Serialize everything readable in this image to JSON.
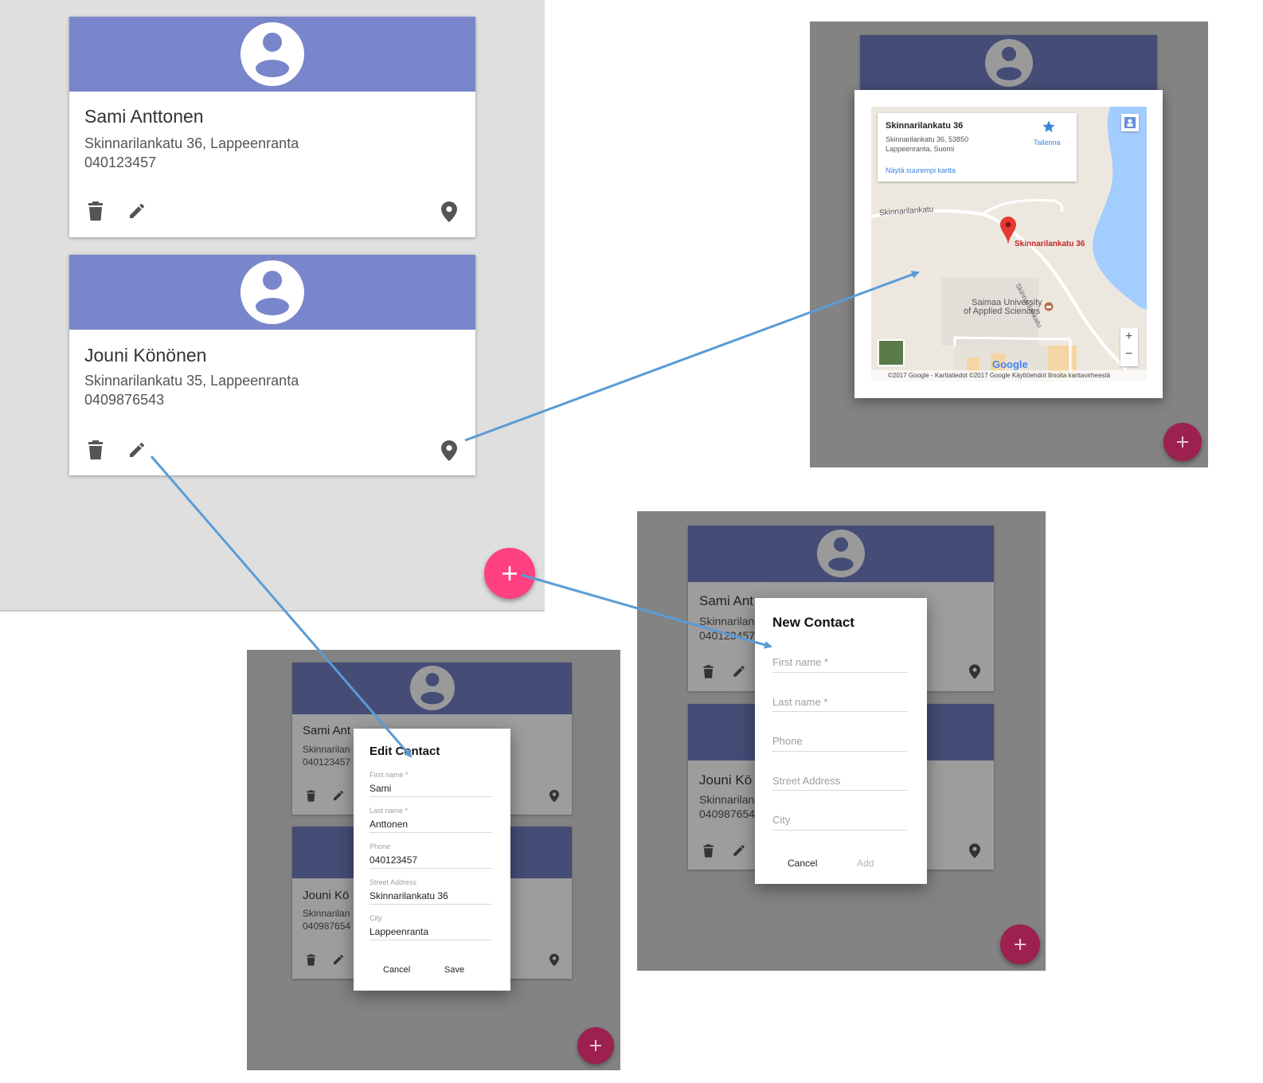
{
  "contacts": [
    {
      "name": "Sami Anttonen",
      "address": "Skinnarilankatu 36, Lappeenranta",
      "phone": "040123457"
    },
    {
      "name": "Jouni Könönen",
      "address": "Skinnarilankatu 35, Lappeenranta",
      "phone": "0409876543"
    }
  ],
  "dim_cards": {
    "edit_view": {
      "name1": "Sami Ant",
      "addr1": "Skinnarilan",
      "phone1": "040123457",
      "name2": "Jouni Kö",
      "addr2": "Skinnarilan",
      "phone2": "040987654"
    },
    "new_view": {
      "name1": "Sami Ant",
      "addr1": "Skinnarilan",
      "phone1": "040123457",
      "name2": "Jouni Kö",
      "addr2": "Skinnarilan",
      "phone2": "040987654"
    }
  },
  "edit_dialog": {
    "title": "Edit Contact",
    "fields": [
      {
        "label": "First name *",
        "value": "Sami"
      },
      {
        "label": "Last name *",
        "value": "Anttonen"
      },
      {
        "label": "Phone",
        "value": "040123457"
      },
      {
        "label": "Street Address",
        "value": "Skinnarilankatu 36"
      },
      {
        "label": "City",
        "value": "Lappeenranta"
      }
    ],
    "cancel_label": "Cancel",
    "save_label": "Save"
  },
  "new_dialog": {
    "title": "New Contact",
    "fields": [
      {
        "label": "First name *"
      },
      {
        "label": "Last name *"
      },
      {
        "label": "Phone"
      },
      {
        "label": "Street Address"
      },
      {
        "label": "City"
      }
    ],
    "cancel_label": "Cancel",
    "add_label": "Add"
  },
  "map": {
    "place_title": "Skinnarilankatu 36",
    "place_address_line1": "Skinnarilankatu 36, 53850",
    "place_address_line2": "Lappeenranta, Suomi",
    "save_label": "Tallenna",
    "larger_map_link": "Näytä suurempi kartta",
    "street_label": "Skinnarilankatu",
    "street_label_diag": "Skinnarilankatu",
    "pin_label": "Skinnarilankatu 36",
    "poi_line1": "Saimaa University",
    "poi_line2": "of Applied Sciences",
    "zoom_in": "+",
    "zoom_out": "−",
    "brand": "Google",
    "footer": "©2017 Google - Karttatiedot ©2017 Google    Käyttöehdot    Ilmoita karttavirheestä"
  },
  "colors": {
    "card_header": "#7986cb",
    "card_header_dim": "#454c76",
    "fab": "#ff4081",
    "fab_dim": "#9c2150",
    "arrow": "#5b9bd5",
    "water": "#a3ccff",
    "map_land": "#ede8df"
  },
  "icons": [
    "account-circle-icon",
    "delete-icon",
    "edit-icon",
    "location-pin-icon",
    "add-icon",
    "star-icon"
  ]
}
